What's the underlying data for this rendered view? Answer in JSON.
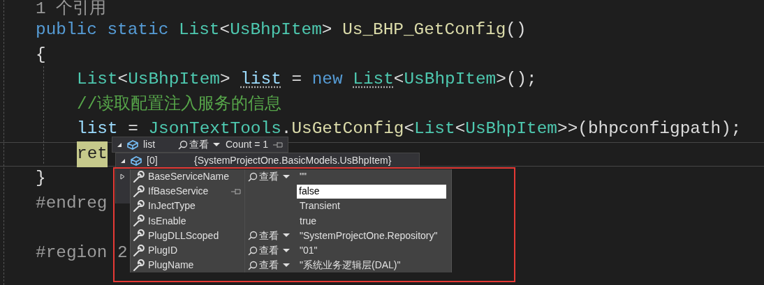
{
  "code_lines": [
    {
      "kind": "codelens",
      "tokens": [
        {
          "text": "1 个引用",
          "kind": "lens"
        }
      ]
    },
    {
      "kind": "code",
      "tokens": [
        {
          "text": "public static ",
          "kind": "keyword"
        },
        {
          "text": "List",
          "kind": "type"
        },
        {
          "text": "<",
          "kind": "plain"
        },
        {
          "text": "UsBhpItem",
          "kind": "type"
        },
        {
          "text": "> ",
          "kind": "plain"
        },
        {
          "text": "Us_BHP_GetConfig",
          "kind": "method"
        },
        {
          "text": "()",
          "kind": "plain"
        }
      ]
    },
    {
      "kind": "code",
      "tokens": [
        {
          "text": "{",
          "kind": "plain"
        }
      ]
    },
    {
      "kind": "code",
      "indented": true,
      "tokens": [
        {
          "text": "List",
          "kind": "type"
        },
        {
          "text": "<",
          "kind": "plain"
        },
        {
          "text": "UsBhpItem",
          "kind": "type"
        },
        {
          "text": "> ",
          "kind": "plain"
        },
        {
          "text": "list",
          "kind": "variable_hint"
        },
        {
          "text": " = ",
          "kind": "plain"
        },
        {
          "text": "new ",
          "kind": "keyword"
        },
        {
          "text": "List",
          "kind": "type_hint"
        },
        {
          "text": "<",
          "kind": "plain"
        },
        {
          "text": "UsBhpItem",
          "kind": "type"
        },
        {
          "text": ">();",
          "kind": "plain"
        }
      ]
    },
    {
      "kind": "code",
      "indented": true,
      "tokens": [
        {
          "text": "//读取配置注入服务的信息",
          "kind": "comment"
        }
      ]
    },
    {
      "kind": "code",
      "indented": true,
      "tokens": [
        {
          "text": "list",
          "kind": "variable"
        },
        {
          "text": " = ",
          "kind": "plain"
        },
        {
          "text": "JsonTextTools",
          "kind": "type"
        },
        {
          "text": ".",
          "kind": "plain"
        },
        {
          "text": "UsGetConfig",
          "kind": "method"
        },
        {
          "text": "<",
          "kind": "plain"
        },
        {
          "text": "List",
          "kind": "type"
        },
        {
          "text": "<",
          "kind": "plain"
        },
        {
          "text": "UsBhpItem",
          "kind": "type"
        },
        {
          "text": ">>(bhpconfigpath);",
          "kind": "plain"
        }
      ]
    },
    {
      "kind": "code",
      "indented": true,
      "current": true,
      "tokens": [
        {
          "text": "ret",
          "kind": "highlight"
        }
      ]
    },
    {
      "kind": "code",
      "tokens": [
        {
          "text": "}",
          "kind": "plain"
        }
      ]
    },
    {
      "kind": "code",
      "tokens": [
        {
          "text": "#endreg",
          "kind": "directive"
        }
      ]
    },
    {
      "kind": "code"
    },
    {
      "kind": "code",
      "tokens": [
        {
          "text": "#region 2",
          "kind": "directive"
        }
      ]
    }
  ],
  "datatip": {
    "header": {
      "expanded": true,
      "name": "list",
      "view_label": "查看",
      "value": "Count = 1"
    },
    "item": {
      "expanded": true,
      "name": "[0]",
      "value": "{SystemProjectOne.BasicModels.UsBhpItem}"
    },
    "properties": [
      {
        "name": "BaseServiceName",
        "expandable": true,
        "pinned_hover": false,
        "editing": false,
        "view_label": "查看",
        "value": "\"\""
      },
      {
        "name": "IfBaseService",
        "expandable": false,
        "pinned_hover": true,
        "editing": true,
        "value": "false"
      },
      {
        "name": "InJectType",
        "expandable": false,
        "pinned_hover": false,
        "editing": false,
        "value": "Transient"
      },
      {
        "name": "IsEnable",
        "expandable": false,
        "pinned_hover": false,
        "editing": false,
        "value": "true"
      },
      {
        "name": "PlugDLLScoped",
        "expandable": false,
        "pinned_hover": false,
        "editing": false,
        "view_label": "查看",
        "value": "\"SystemProjectOne.Repository\""
      },
      {
        "name": "PlugID",
        "expandable": false,
        "pinned_hover": false,
        "editing": false,
        "view_label": "查看",
        "value": "\"01\""
      },
      {
        "name": "PlugName",
        "expandable": false,
        "pinned_hover": false,
        "editing": false,
        "view_label": "查看",
        "value": "\"系统业务逻辑层(DAL)\""
      }
    ]
  }
}
